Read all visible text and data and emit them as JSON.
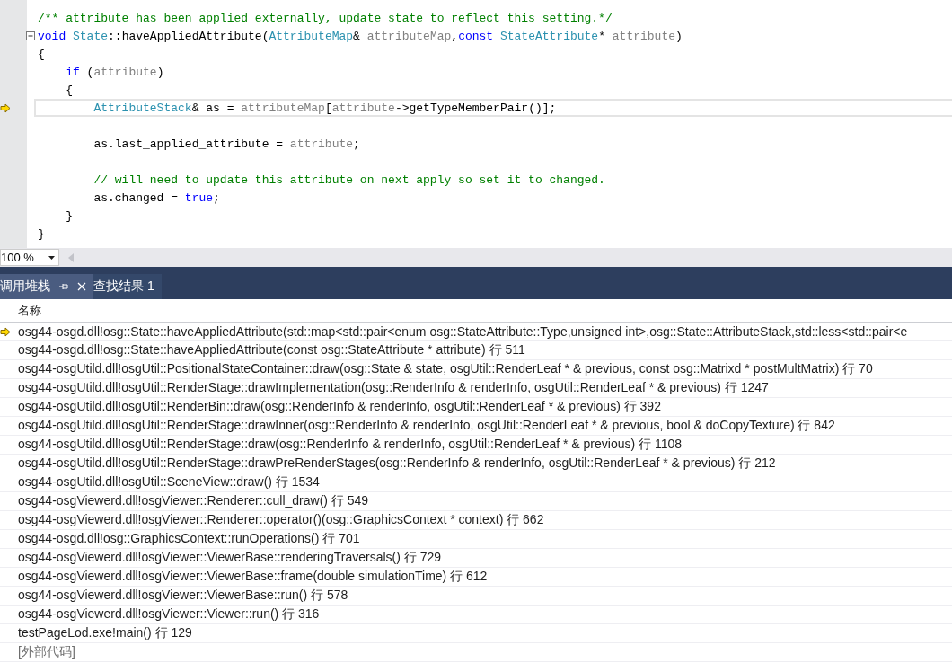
{
  "editor": {
    "lines": [
      {
        "current": false,
        "tokens": [
          {
            "kind": "comment",
            "text": "/** attribute has been applied externally, update state to reflect this setting.*/"
          }
        ]
      },
      {
        "current": false,
        "foldable": true,
        "tokens": [
          {
            "kind": "keyword",
            "text": "void"
          },
          {
            "kind": "type",
            "text": " State"
          },
          {
            "kind": "plain",
            "text": "::haveAppliedAttribute("
          },
          {
            "kind": "type",
            "text": "AttributeMap"
          },
          {
            "kind": "plain",
            "text": "& "
          },
          {
            "kind": "param",
            "text": "attributeMap"
          },
          {
            "kind": "plain",
            "text": ","
          },
          {
            "kind": "keyword",
            "text": "const"
          },
          {
            "kind": "type",
            "text": " StateAttribute"
          },
          {
            "kind": "plain",
            "text": "* "
          },
          {
            "kind": "param",
            "text": "attribute"
          },
          {
            "kind": "plain",
            "text": ")"
          }
        ]
      },
      {
        "current": false,
        "tokens": [
          {
            "kind": "plain",
            "text": "{"
          }
        ]
      },
      {
        "current": false,
        "tokens": [
          {
            "kind": "keyword",
            "text": "    if"
          },
          {
            "kind": "plain",
            "text": " ("
          },
          {
            "kind": "param",
            "text": "attribute"
          },
          {
            "kind": "plain",
            "text": ")"
          }
        ]
      },
      {
        "current": false,
        "tokens": [
          {
            "kind": "plain",
            "text": "    {"
          }
        ]
      },
      {
        "current": true,
        "tokens": [
          {
            "kind": "type",
            "text": "        AttributeStack"
          },
          {
            "kind": "plain",
            "text": "& as = "
          },
          {
            "kind": "param",
            "text": "attributeMap"
          },
          {
            "kind": "plain",
            "text": "["
          },
          {
            "kind": "param",
            "text": "attribute"
          },
          {
            "kind": "plain",
            "text": "->getTypeMemberPair()];"
          }
        ]
      },
      {
        "current": false
      },
      {
        "current": false,
        "tokens": [
          {
            "kind": "plain",
            "text": "        as.last_applied_attribute = "
          },
          {
            "kind": "param",
            "text": "attribute"
          },
          {
            "kind": "plain",
            "text": ";"
          }
        ]
      },
      {
        "current": false
      },
      {
        "current": false,
        "tokens": [
          {
            "kind": "comment",
            "text": "        // will need to update this attribute on next apply so set it to changed."
          }
        ]
      },
      {
        "current": false,
        "tokens": [
          {
            "kind": "plain",
            "text": "        as.changed = "
          },
          {
            "kind": "keyword",
            "text": "true"
          },
          {
            "kind": "plain",
            "text": ";"
          }
        ]
      },
      {
        "current": false,
        "tokens": [
          {
            "kind": "plain",
            "text": "    }"
          }
        ]
      },
      {
        "current": false,
        "tokens": [
          {
            "kind": "plain",
            "text": "}"
          }
        ]
      }
    ]
  },
  "zoom": {
    "value": "100 %"
  },
  "panel_tabs": [
    {
      "label": "调用堆栈",
      "selected": true
    },
    {
      "label": "查找结果 1",
      "selected": false
    }
  ],
  "call_stack": {
    "columns": [
      "名称"
    ],
    "rows": [
      {
        "text": "osg44-osgd.dll!osg::State::haveAppliedAttribute(std::map<std::pair<enum osg::StateAttribute::Type,unsigned int>,osg::State::AttributeStack,std::less<std::pair<e",
        "current": true,
        "external": false
      },
      {
        "text": "osg44-osgd.dll!osg::State::haveAppliedAttribute(const osg::StateAttribute * attribute) 行 511",
        "current": false,
        "external": false
      },
      {
        "text": "osg44-osgUtild.dll!osgUtil::PositionalStateContainer::draw(osg::State & state, osgUtil::RenderLeaf * & previous, const osg::Matrixd * postMultMatrix) 行 70",
        "current": false,
        "external": false
      },
      {
        "text": "osg44-osgUtild.dll!osgUtil::RenderStage::drawImplementation(osg::RenderInfo & renderInfo, osgUtil::RenderLeaf * & previous) 行 1247",
        "current": false,
        "external": false
      },
      {
        "text": "osg44-osgUtild.dll!osgUtil::RenderBin::draw(osg::RenderInfo & renderInfo, osgUtil::RenderLeaf * & previous) 行 392",
        "current": false,
        "external": false
      },
      {
        "text": "osg44-osgUtild.dll!osgUtil::RenderStage::drawInner(osg::RenderInfo & renderInfo, osgUtil::RenderLeaf * & previous, bool & doCopyTexture) 行 842",
        "current": false,
        "external": false
      },
      {
        "text": "osg44-osgUtild.dll!osgUtil::RenderStage::draw(osg::RenderInfo & renderInfo, osgUtil::RenderLeaf * & previous) 行 1108",
        "current": false,
        "external": false
      },
      {
        "text": "osg44-osgUtild.dll!osgUtil::RenderStage::drawPreRenderStages(osg::RenderInfo & renderInfo, osgUtil::RenderLeaf * & previous) 行 212",
        "current": false,
        "external": false
      },
      {
        "text": "osg44-osgUtild.dll!osgUtil::SceneView::draw() 行 1534",
        "current": false,
        "external": false
      },
      {
        "text": "osg44-osgViewerd.dll!osgViewer::Renderer::cull_draw() 行 549",
        "current": false,
        "external": false
      },
      {
        "text": "osg44-osgViewerd.dll!osgViewer::Renderer::operator()(osg::GraphicsContext * context) 行 662",
        "current": false,
        "external": false
      },
      {
        "text": "osg44-osgd.dll!osg::GraphicsContext::runOperations() 行 701",
        "current": false,
        "external": false
      },
      {
        "text": "osg44-osgViewerd.dll!osgViewer::ViewerBase::renderingTraversals() 行 729",
        "current": false,
        "external": false
      },
      {
        "text": "osg44-osgViewerd.dll!osgViewer::ViewerBase::frame(double simulationTime) 行 612",
        "current": false,
        "external": false
      },
      {
        "text": "osg44-osgViewerd.dll!osgViewer::ViewerBase::run() 行 578",
        "current": false,
        "external": false
      },
      {
        "text": "osg44-osgViewerd.dll!osgViewer::Viewer::run() 行 316",
        "current": false,
        "external": false
      },
      {
        "text": "testPageLod.exe!main() 行 129",
        "current": false,
        "external": false
      },
      {
        "text": "[外部代码]",
        "current": false,
        "external": true
      }
    ]
  }
}
